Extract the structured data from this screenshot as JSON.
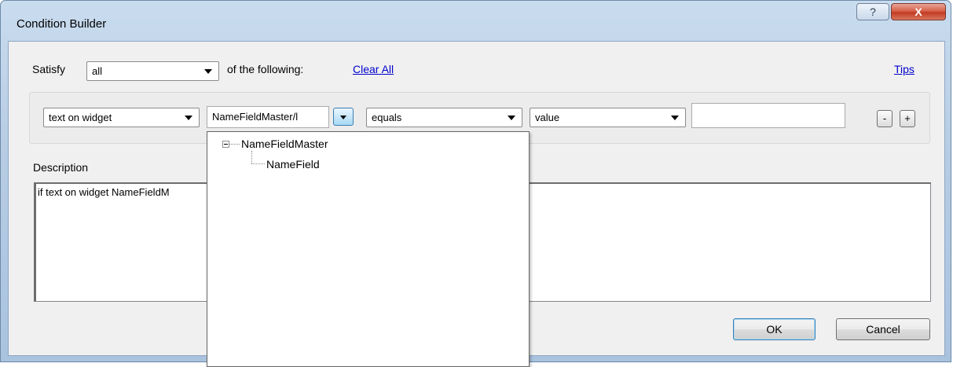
{
  "window": {
    "title": "Condition Builder",
    "help_label": "?",
    "close_label": "X"
  },
  "satisfy": {
    "label": "Satisfy",
    "selected": "all",
    "suffix": "of the following:",
    "clear_all": "Clear All",
    "tips": "Tips"
  },
  "condition": {
    "type_selected": "text on widget",
    "widget_value": "NameFieldMaster/l",
    "operator_selected": "equals",
    "operand_selected": "value",
    "value_input": "",
    "remove_label": "-",
    "add_label": "+"
  },
  "widget_tree": {
    "nodes": [
      {
        "label": "NameFieldMaster"
      },
      {
        "label": "NameField"
      }
    ]
  },
  "description": {
    "label": "Description",
    "text": "if text on widget NameFieldM"
  },
  "footer": {
    "ok_label": "OK",
    "cancel_label": "Cancel"
  }
}
